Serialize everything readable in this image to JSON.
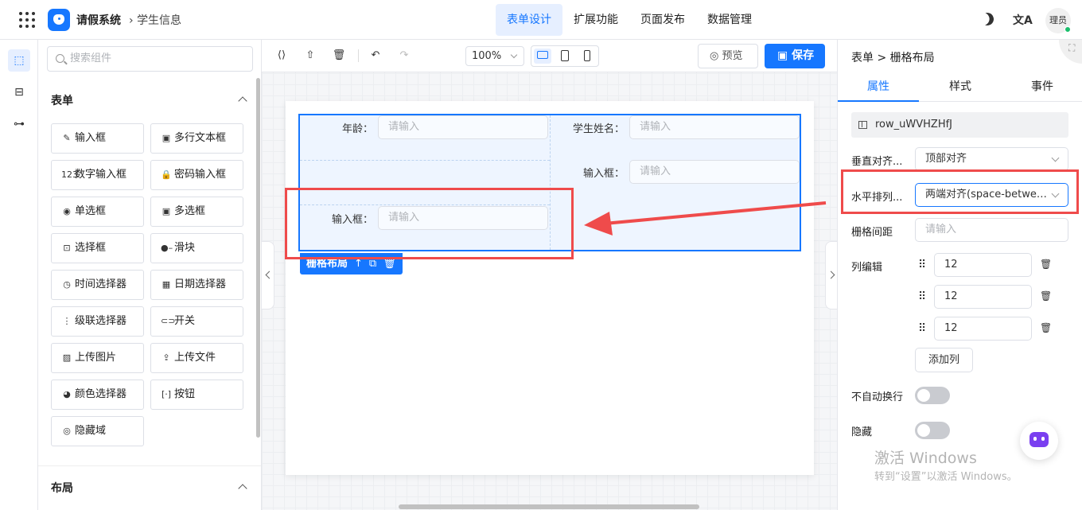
{
  "header": {
    "app_title": "请假系统",
    "breadcrumb": "学生信息",
    "tabs": [
      {
        "label": "表单设计",
        "active": true
      },
      {
        "label": "扩展功能",
        "active": false
      },
      {
        "label": "页面发布",
        "active": false
      },
      {
        "label": "数据管理",
        "active": false
      }
    ],
    "translate_glyph": "文A",
    "avatar_text": "理员"
  },
  "components": {
    "search_placeholder": "搜索组件",
    "form_section": "表单",
    "layout_section": "布局",
    "items": [
      {
        "label": "输入框",
        "icon": "pencil-icon",
        "glyph": "✎"
      },
      {
        "label": "多行文本框",
        "icon": "textarea-icon",
        "glyph": "▣"
      },
      {
        "label": "数字输入框",
        "icon": "number-icon",
        "glyph": "123"
      },
      {
        "label": "密码输入框",
        "icon": "lock-icon",
        "glyph": "🔒"
      },
      {
        "label": "单选框",
        "icon": "radio-icon",
        "glyph": "◉"
      },
      {
        "label": "多选框",
        "icon": "checkbox-icon",
        "glyph": "▣"
      },
      {
        "label": "选择框",
        "icon": "select-icon",
        "glyph": "⊡"
      },
      {
        "label": "滑块",
        "icon": "slider-icon",
        "glyph": "●–"
      },
      {
        "label": "时间选择器",
        "icon": "clock-icon",
        "glyph": "◷"
      },
      {
        "label": "日期选择器",
        "icon": "calendar-icon",
        "glyph": "▦"
      },
      {
        "label": "级联选择器",
        "icon": "cascader-icon",
        "glyph": "⋮"
      },
      {
        "label": "开关",
        "icon": "switch-icon",
        "glyph": "⊂⊃"
      },
      {
        "label": "上传图片",
        "icon": "image-icon",
        "glyph": "▨"
      },
      {
        "label": "上传文件",
        "icon": "upload-icon",
        "glyph": "⇪"
      },
      {
        "label": "颜色选择器",
        "icon": "palette-icon",
        "glyph": "◕"
      },
      {
        "label": "按钮",
        "icon": "button-icon",
        "glyph": "[·]"
      },
      {
        "label": "隐藏域",
        "icon": "eye-off-icon",
        "glyph": "◎"
      }
    ]
  },
  "toolbar": {
    "zoom": "100%",
    "preview_label": "预览",
    "save_label": "保存"
  },
  "canvas": {
    "fields": [
      {
        "label": "年龄：",
        "placeholder": "请输入"
      },
      {
        "label": "学生姓名：",
        "placeholder": "请输入"
      },
      {
        "label": "输入框：",
        "placeholder": "请输入"
      },
      {
        "label": "输入框：",
        "placeholder": "请输入"
      }
    ],
    "grid_tag_label": "栅格布局"
  },
  "props": {
    "breadcrumb_root": "表单",
    "breadcrumb_sep": ">",
    "breadcrumb_leaf": "栅格布局",
    "tabs": [
      {
        "label": "属性",
        "active": true
      },
      {
        "label": "样式",
        "active": false
      },
      {
        "label": "事件",
        "active": false
      }
    ],
    "row_id": "row_uWVHZHfJ",
    "vertical_align_label": "垂直对齐...",
    "vertical_align_value": "顶部对齐",
    "horizontal_label": "水平排列...",
    "horizontal_value": "两端对齐(space-between)",
    "gutter_label": "栅格间距",
    "gutter_placeholder": "请输入",
    "columns_label": "列编辑",
    "columns": [
      "12",
      "12",
      "12"
    ],
    "add_column": "添加列",
    "nowrap_label": "不自动换行",
    "nowrap_on": false,
    "hidden_label": "隐藏",
    "hidden_on": false
  },
  "watermark": {
    "line1": "激活 Windows",
    "line2": "转到“设置”以激活 Windows。"
  },
  "colors": {
    "accent": "#1677ff",
    "annotation": "#ef4b4b"
  }
}
